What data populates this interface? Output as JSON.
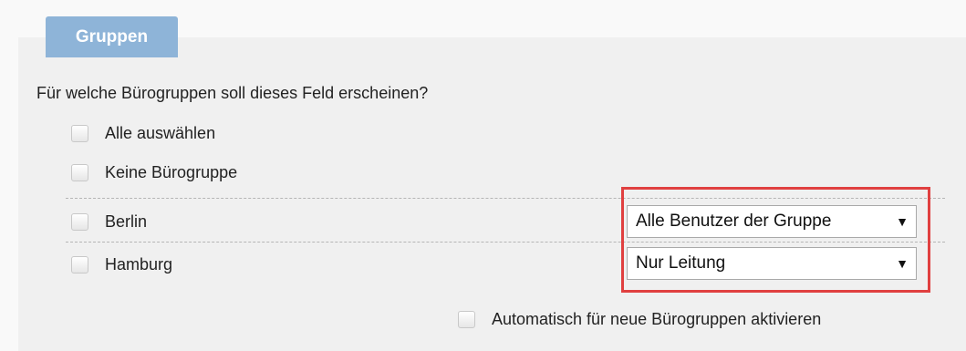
{
  "tab": {
    "label": "Gruppen"
  },
  "question": "Für welche Bürogruppen soll dieses Feld erscheinen?",
  "options": {
    "select_all": "Alle auswählen",
    "no_group": "Keine Bürogruppe"
  },
  "groups": [
    {
      "name": "Berlin",
      "selected_value": "Alle Benutzer der Gruppe"
    },
    {
      "name": "Hamburg",
      "selected_value": "Nur Leitung"
    }
  ],
  "auto_activate": "Automatisch für neue Bürogruppen aktivieren",
  "colors": {
    "tab_bg": "#8eb4d8",
    "highlight": "#e04040"
  }
}
